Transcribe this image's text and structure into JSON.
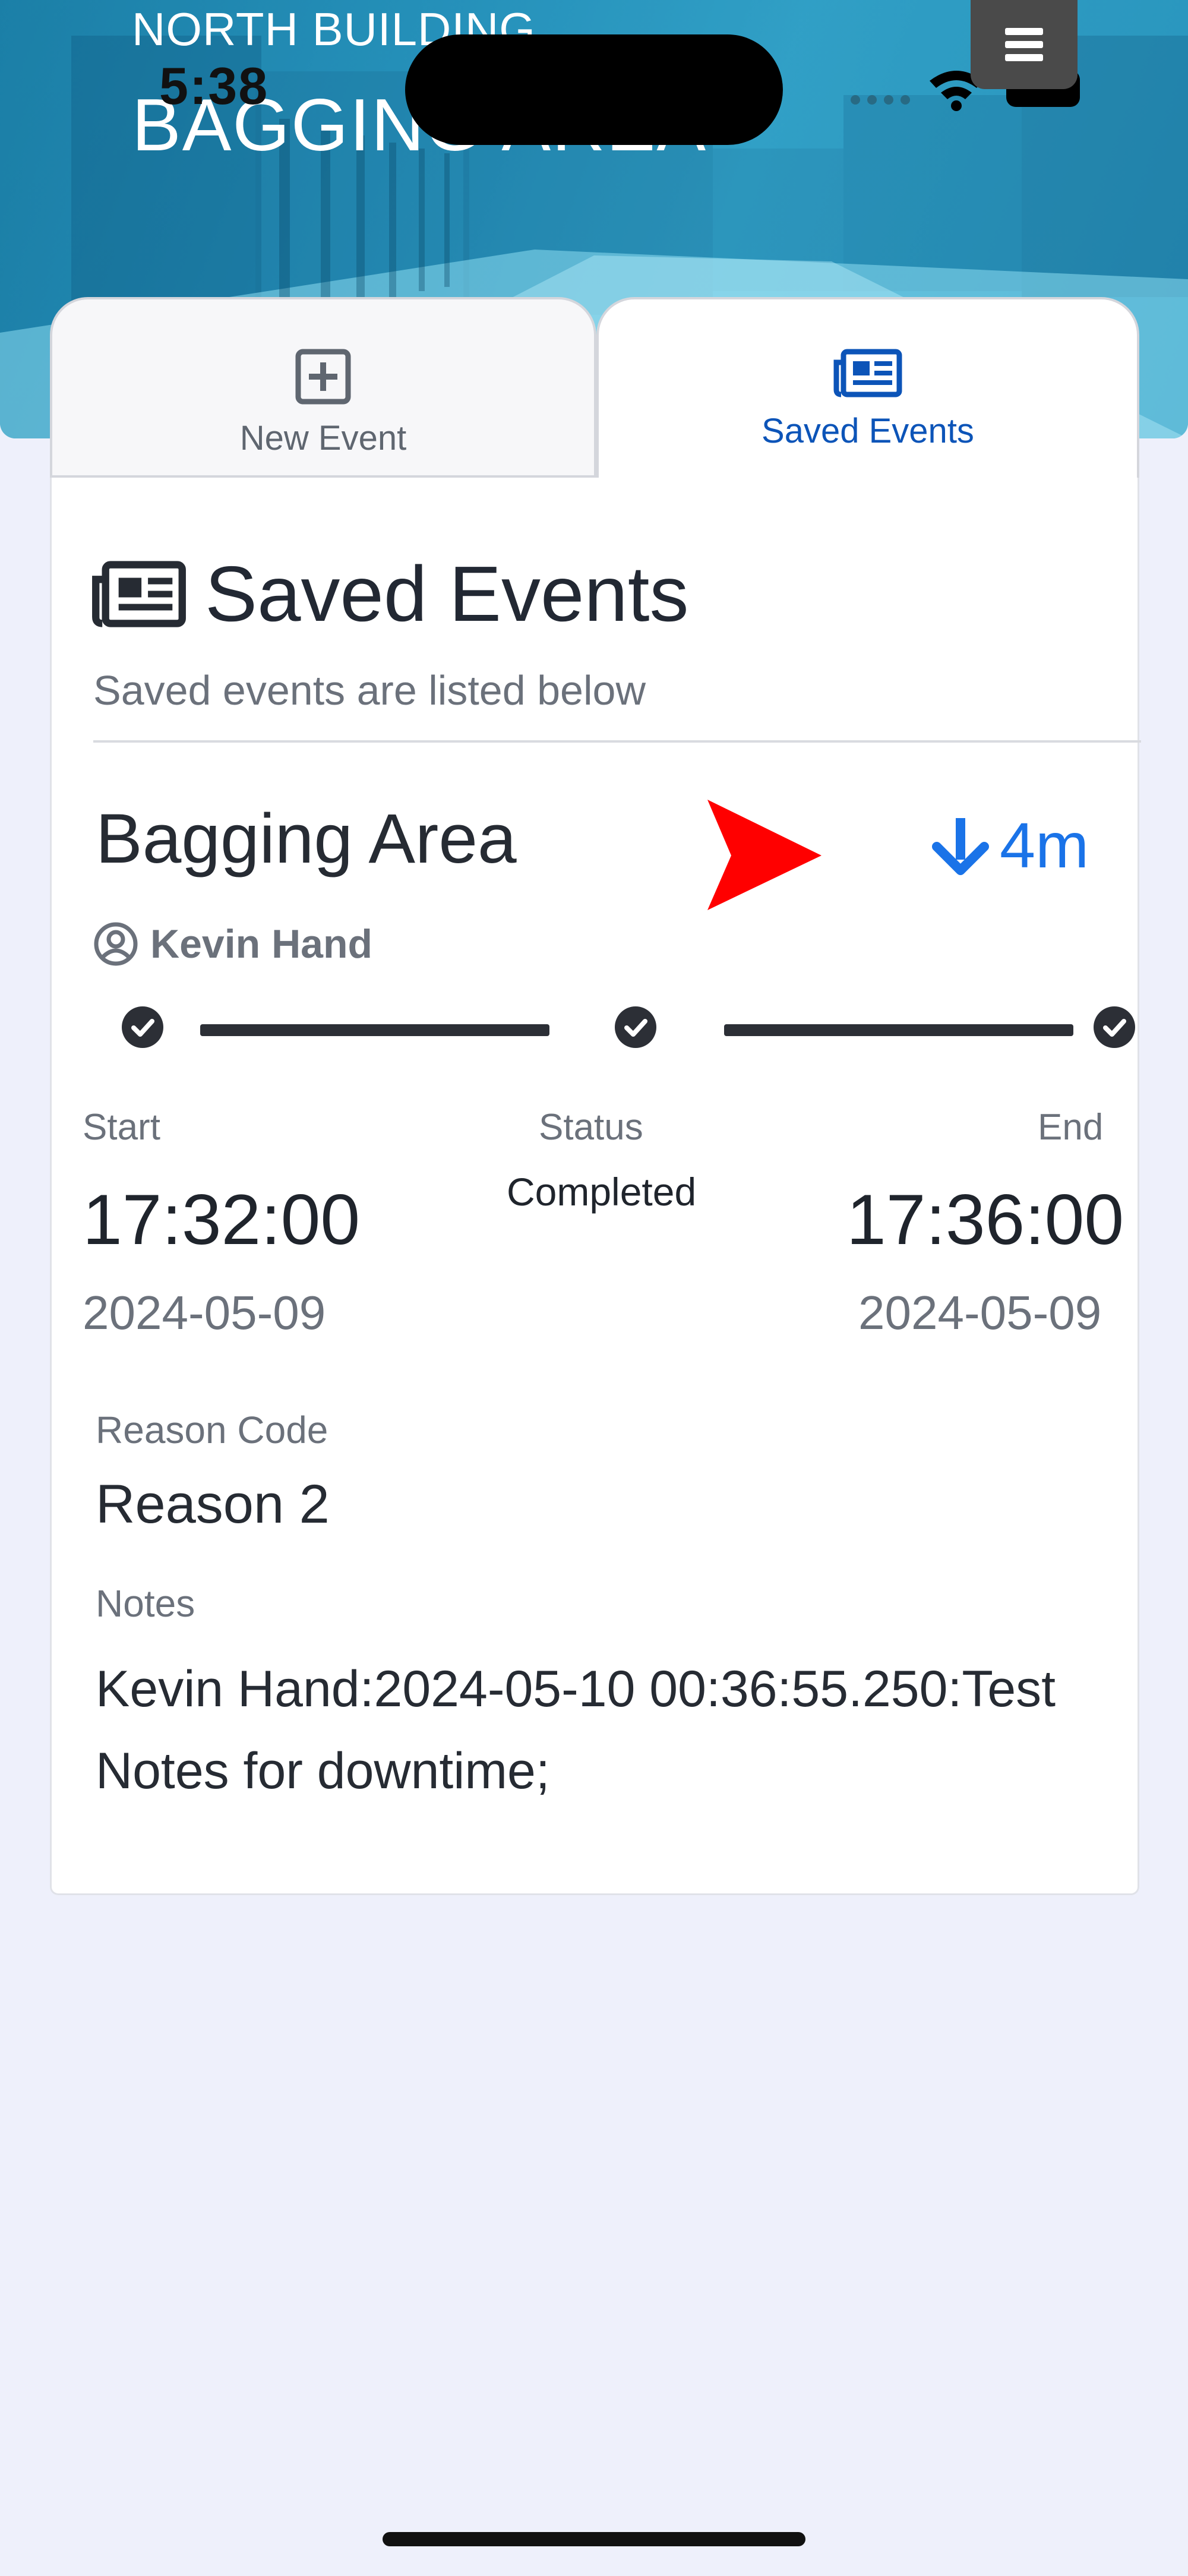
{
  "header": {
    "location": "NORTH BUILDING",
    "area": "BAGGING AREA"
  },
  "status_bar": {
    "time": "5:38"
  },
  "tabs": [
    {
      "label": "New Event",
      "icon": "plus-square-icon",
      "active": false
    },
    {
      "label": "Saved Events",
      "icon": "newspaper-icon",
      "active": true
    }
  ],
  "saved_events": {
    "title": "Saved Events",
    "subtitle": "Saved events are listed below"
  },
  "event": {
    "name": "Bagging Area",
    "duration": "4m",
    "user": "Kevin Hand",
    "steps_completed": 3,
    "steps_total": 3,
    "start_label": "Start",
    "start_time": "17:32:00",
    "start_date": "2024-05-09",
    "status_label": "Status",
    "status": "Completed",
    "end_label": "End",
    "end_time": "17:36:00",
    "end_date": "2024-05-09",
    "reason_label": "Reason Code",
    "reason": "Reason 2",
    "notes_label": "Notes",
    "notes": "Kevin Hand:2024-05-10 00:36:55.250:Test Notes for downtime;"
  },
  "colors": {
    "accent_blue": "#1a73e8",
    "tab_active_text": "#0c54b8",
    "pointer_red": "#ff0000",
    "banner_teal": "#2a98c2"
  }
}
